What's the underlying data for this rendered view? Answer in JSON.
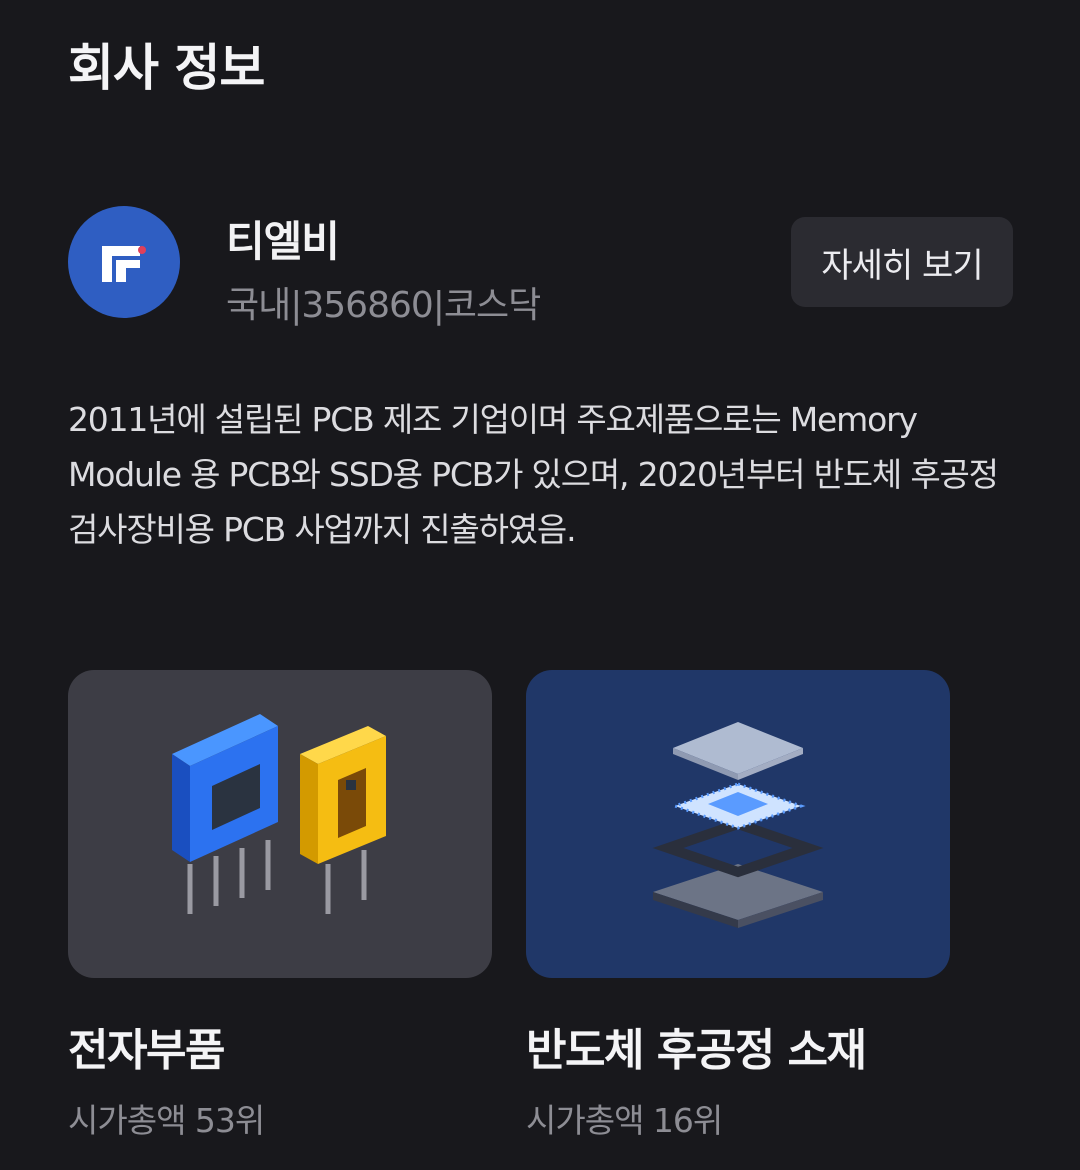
{
  "page": {
    "title": "회사 정보"
  },
  "company": {
    "name": "티엘비",
    "meta": "국내|356860|코스닥",
    "detail_button": "자세히 보기",
    "logo_icon": "tlb-logo-icon",
    "description": "2011년에 설립된 PCB 제조 기업이며 주요제품으로는 Memory Module 용 PCB와 SSD용 PCB가 있으며, 2020년부터 반도체 후공정 검사장비용 PCB 사업까지 진출하였음."
  },
  "sectors": [
    {
      "title": "전자부품",
      "subtitle": "시가총액 53위",
      "icon": "electronic-components-icon",
      "color": "#3d3d45"
    },
    {
      "title": "반도체 후공정 소재",
      "subtitle": "시가총액 16위",
      "icon": "semiconductor-package-icon",
      "color": "#203768"
    }
  ],
  "colors": {
    "background": "#18181c",
    "accent": "#2f5ec2"
  }
}
